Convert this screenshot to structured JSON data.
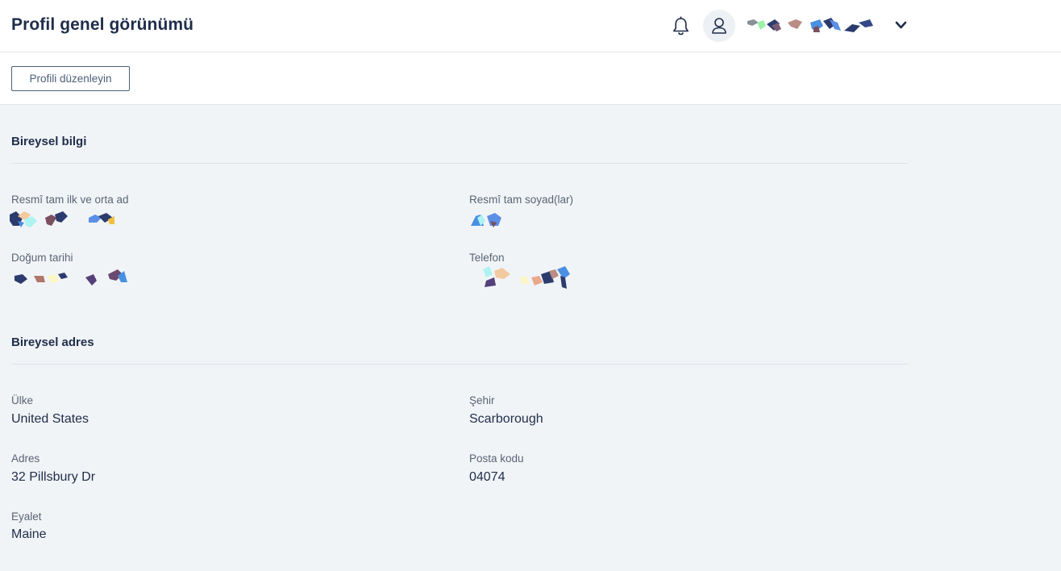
{
  "header": {
    "title": "Profil genel görünümü",
    "notifications_icon": "bell-icon",
    "avatar_icon": "user-icon",
    "menu_icon": "chevron-down-icon"
  },
  "actions": {
    "edit_profile_label": "Profili düzenleyin"
  },
  "personal_info": {
    "title": "Bireysel bilgi",
    "fields": [
      {
        "label": "Resmî tam ilk ve orta ad"
      },
      {
        "label": "Resmî tam soyad(lar)"
      },
      {
        "label": "Doğum tarihi"
      },
      {
        "label": "Telefon"
      }
    ]
  },
  "personal_address": {
    "title": "Bireysel adres",
    "fields": [
      {
        "label": "Ülke",
        "value": "United States"
      },
      {
        "label": "Şehir",
        "value": "Scarborough"
      },
      {
        "label": "Adres",
        "value": "32 Pillsbury Dr"
      },
      {
        "label": "Posta kodu",
        "value": "04074"
      },
      {
        "label": "Eyalet",
        "value": "Maine"
      }
    ]
  },
  "colors": {
    "text_primary": "#1f2d4a",
    "text_label": "#5a6475",
    "background": "#f1f4f7",
    "surface": "#ffffff",
    "border": "#dde2e8"
  }
}
